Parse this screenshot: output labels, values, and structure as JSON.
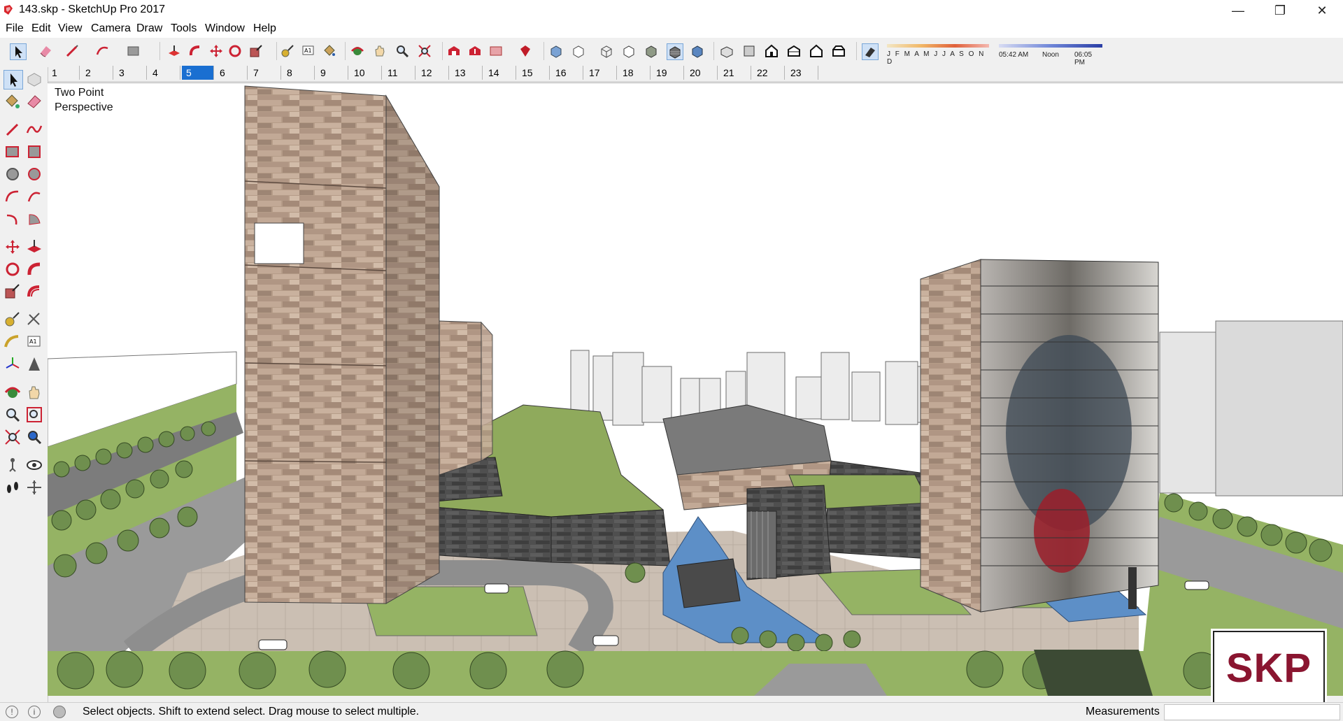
{
  "window": {
    "title": "143.skp - SketchUp Pro 2017",
    "minimize": "—",
    "maximize": "❐",
    "close": "✕"
  },
  "menu": [
    "File",
    "Edit",
    "View",
    "Camera",
    "Draw",
    "Tools",
    "Window",
    "Help"
  ],
  "shadow": {
    "months": "J F M A M J J A S O N D",
    "time_start": "05:42 AM",
    "time_mid": "Noon",
    "time_end": "06:05 PM"
  },
  "scenes": [
    "1",
    "2",
    "3",
    "4",
    "5",
    "6",
    "7",
    "8",
    "9",
    "10",
    "11",
    "12",
    "13",
    "14",
    "15",
    "16",
    "17",
    "18",
    "19",
    "20",
    "21",
    "22",
    "23"
  ],
  "active_scene": "5",
  "view_label": {
    "line1": "Two Point",
    "line2": "Perspective"
  },
  "status": {
    "hint": "Select objects. Shift to extend select. Drag mouse to select multiple.",
    "measurements_label": "Measurements",
    "measurements_value": ""
  },
  "badge": {
    "text": "SKP"
  },
  "colors": {
    "active_tab": "#1a6fd1",
    "badge_text": "#8a1530",
    "grass": "#8fae5a",
    "stone": "#b49a86"
  }
}
